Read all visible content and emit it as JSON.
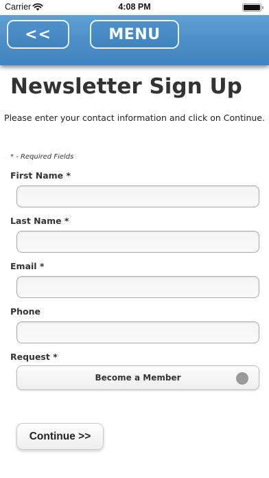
{
  "status_bar": {
    "carrier": "Carrier",
    "time": "4:08 PM",
    "battery_level": 1.0
  },
  "header": {
    "back_label": "<<",
    "menu_label": "MENU"
  },
  "page": {
    "title": "Newsletter Sign Up",
    "intro": "Please enter your contact information and click on Continue.",
    "required_note": "* - Required Fields"
  },
  "form": {
    "first_name": {
      "label": "First Name *",
      "value": ""
    },
    "last_name": {
      "label": "Last Name *",
      "value": ""
    },
    "email": {
      "label": "Email *",
      "value": ""
    },
    "phone": {
      "label": "Phone",
      "value": ""
    },
    "request": {
      "label": "Request *",
      "selected": "Become a Member"
    }
  },
  "continue_label": "Continue >>"
}
